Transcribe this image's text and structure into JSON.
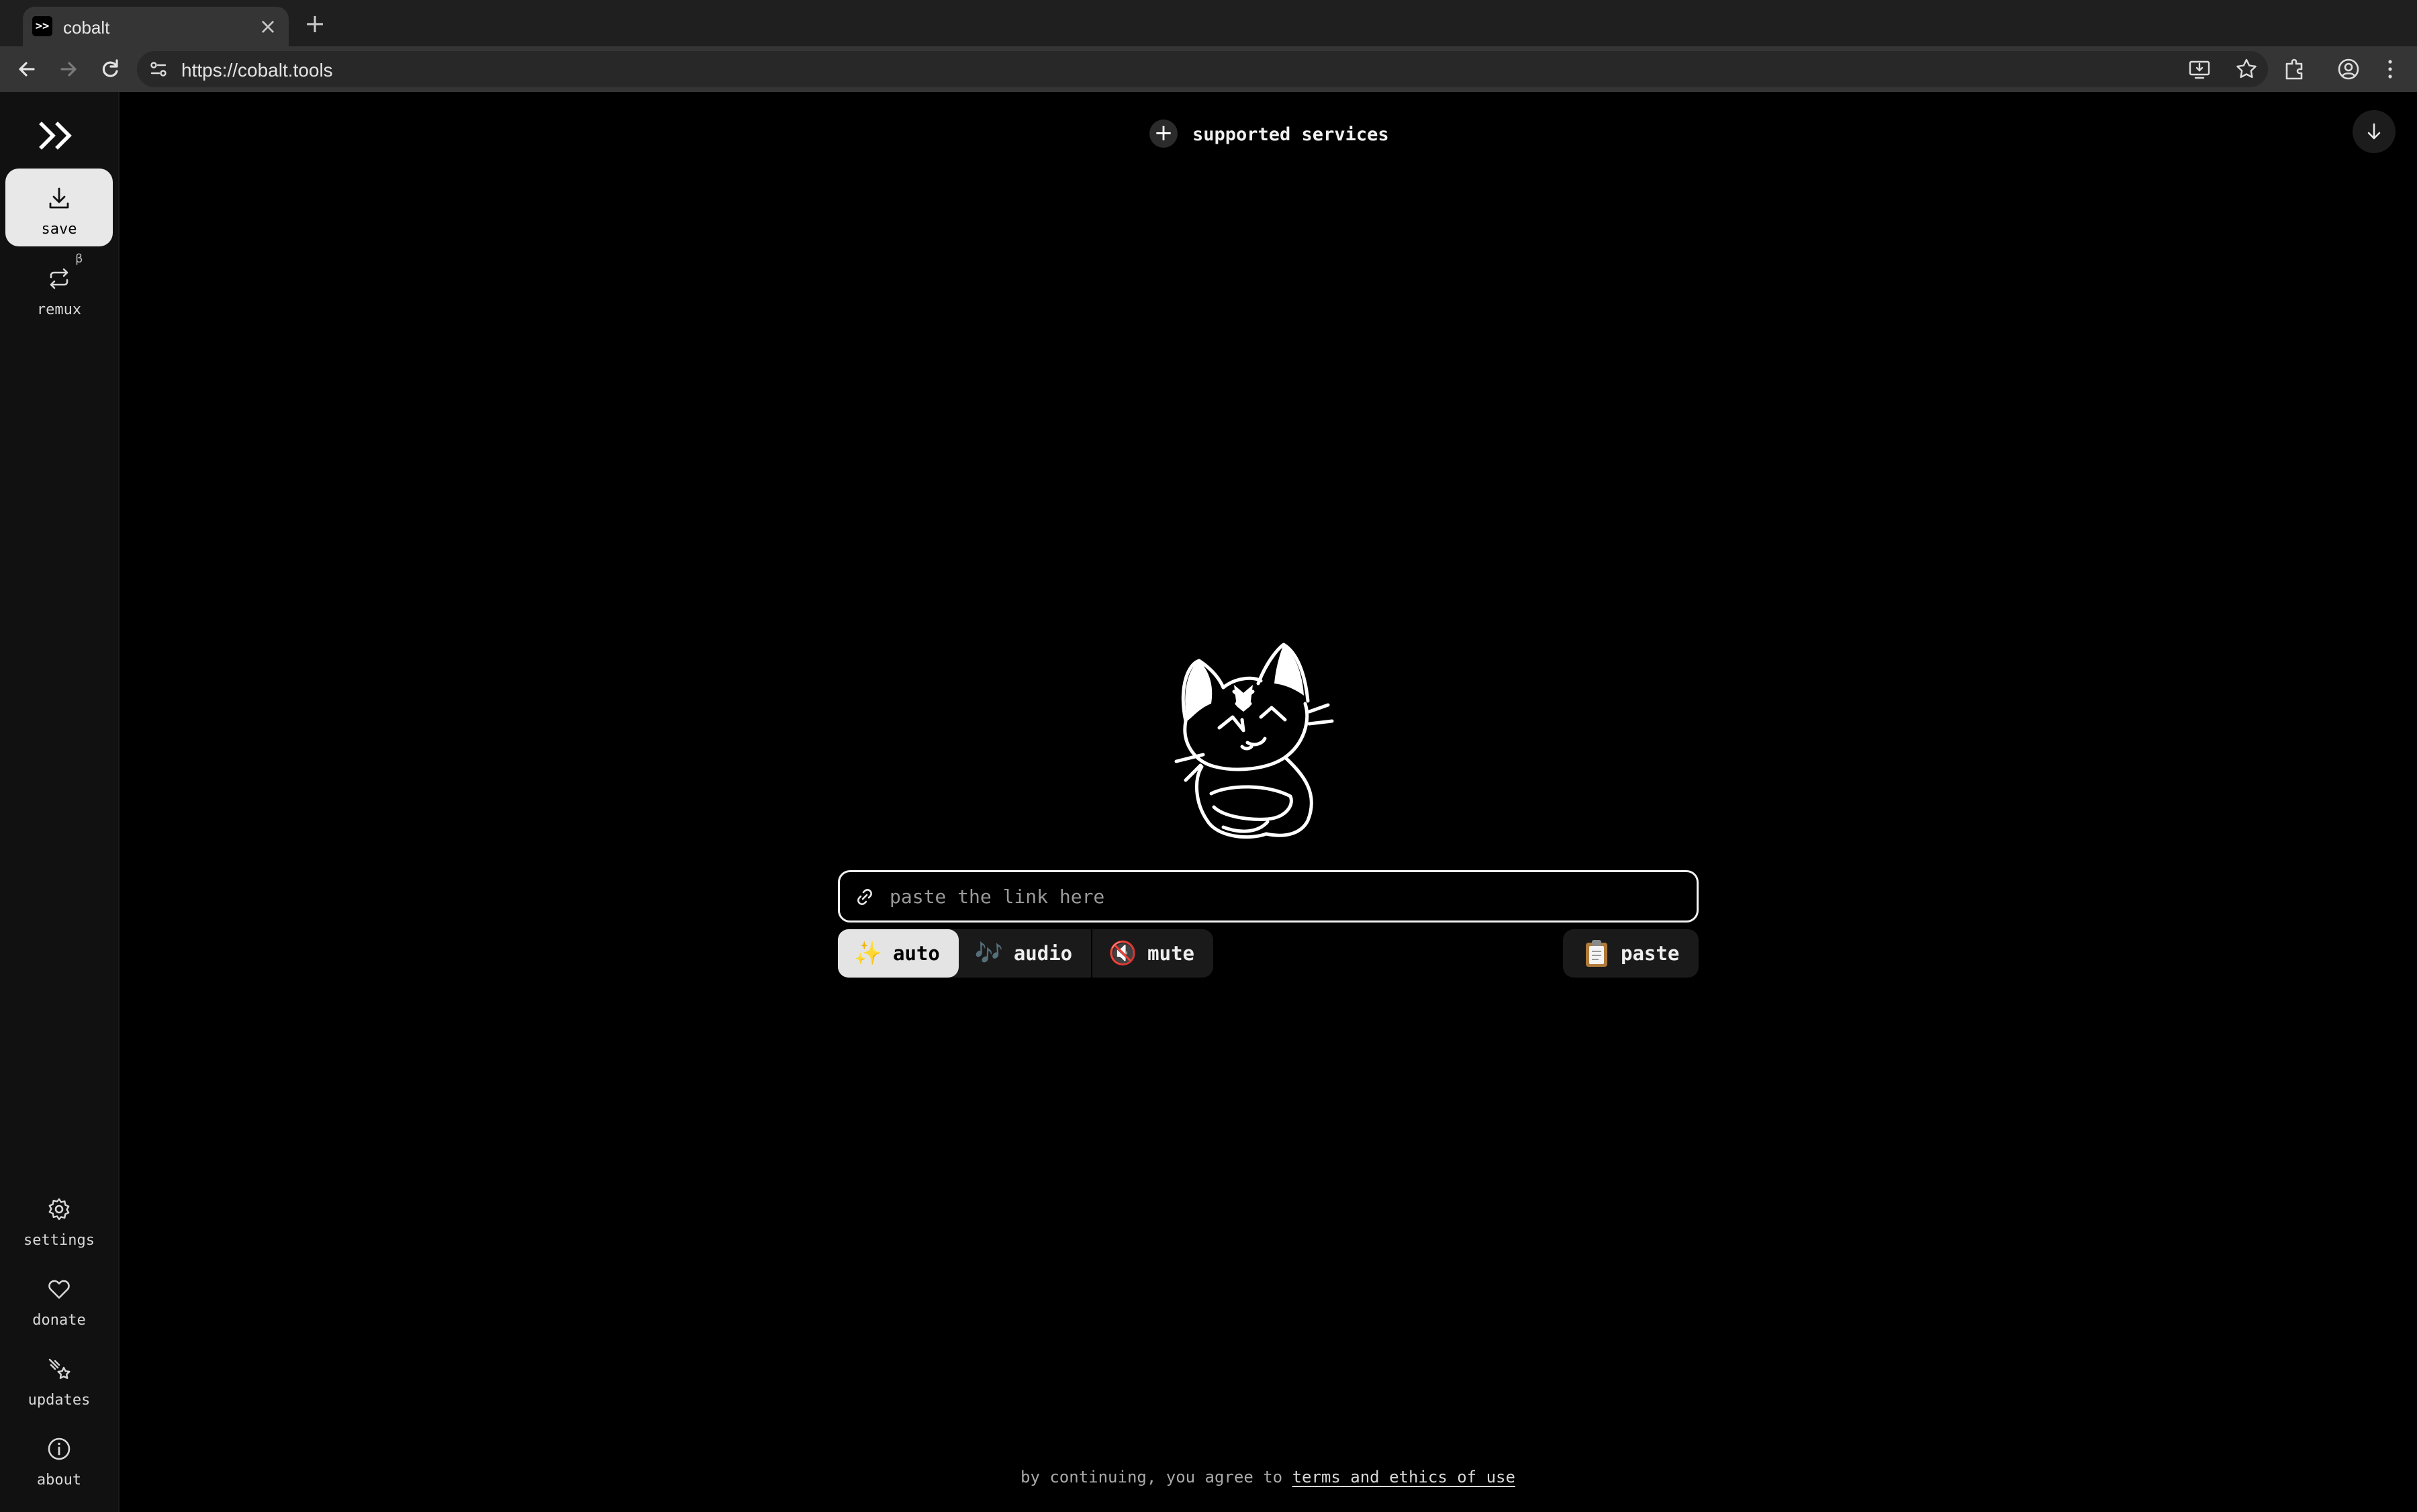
{
  "browser": {
    "tab_title": "cobalt",
    "favicon_text": ">>",
    "url": "https://cobalt.tools"
  },
  "sidebar": {
    "logo": ">>",
    "items_top": [
      {
        "label": "save",
        "icon": "download-icon",
        "active": true
      },
      {
        "label": "remux",
        "icon": "remux-icon",
        "badge": "β"
      }
    ],
    "items_bottom": [
      {
        "label": "settings",
        "icon": "gear-icon"
      },
      {
        "label": "donate",
        "icon": "heart-icon"
      },
      {
        "label": "updates",
        "icon": "comet-icon"
      },
      {
        "label": "about",
        "icon": "info-icon"
      }
    ]
  },
  "header": {
    "services_label": "supported services",
    "services_icon": "plus-icon",
    "queue_icon": "arrow-down-icon"
  },
  "omnibox": {
    "placeholder": "paste the link here",
    "value": ""
  },
  "modes": [
    {
      "label": "auto",
      "emoji": "✨",
      "active": true
    },
    {
      "label": "audio",
      "emoji": "🎶",
      "active": false
    },
    {
      "label": "mute",
      "emoji": "🔇",
      "active": false
    }
  ],
  "paste": {
    "label": "paste",
    "emoji": "📋"
  },
  "footer": {
    "prefix": "by continuing, you agree to ",
    "link": "terms and ethics of use"
  },
  "colors": {
    "background": "#000000",
    "sidebar": "#111111",
    "active_button": "#e4e4e4",
    "text": "#e1e1e1"
  }
}
